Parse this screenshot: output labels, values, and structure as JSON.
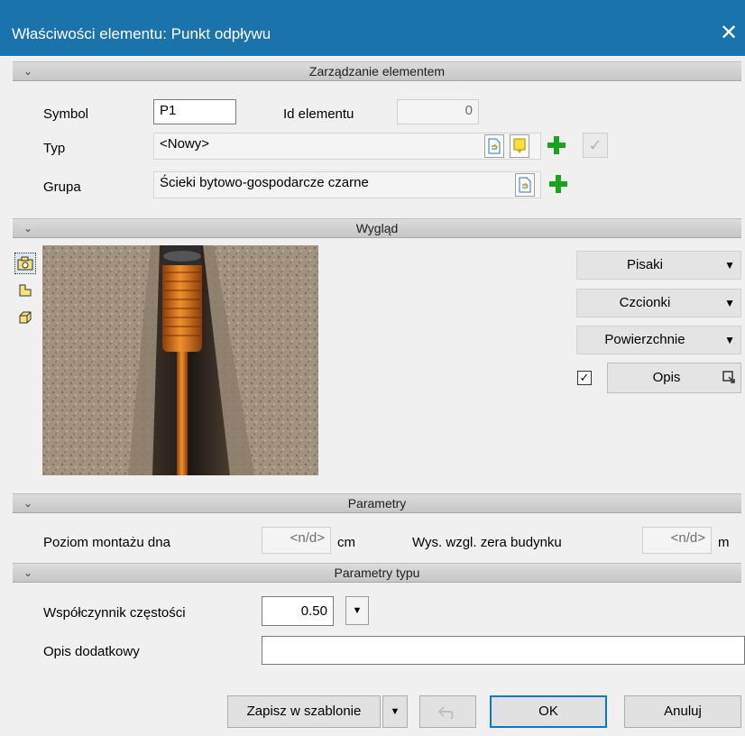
{
  "window": {
    "title": "Właściwości elementu: Punkt odpływu",
    "close_glyph": "✕"
  },
  "sections": {
    "management": "Zarządzanie elementem",
    "appearance": "Wygląd",
    "parameters": "Parametry",
    "type_parameters": "Parametry typu",
    "chevron_glyph": "⌄"
  },
  "management": {
    "symbol_label": "Symbol",
    "symbol_value": "P1",
    "id_label": "Id elementu",
    "id_value": "0",
    "type_label": "Typ",
    "type_value": "<Nowy>",
    "group_label": "Grupa",
    "group_value": "Ścieki bytowo-gospodarcze czarne",
    "apply_glyph": "✓"
  },
  "appearance": {
    "view_tabs": [
      "camera-icon",
      "plan-view-icon",
      "3d-box-icon"
    ],
    "pens_label": "Pisaki",
    "fonts_label": "Czcionki",
    "surfaces_label": "Powierzchnie",
    "dropdown_glyph": "▼",
    "description_checked": true,
    "description_check_glyph": "✓",
    "description_label": "Opis"
  },
  "parameters": {
    "mount_level_label": "Poziom montażu dna",
    "mount_level_value": "<n/d>",
    "mount_level_unit": "cm",
    "height_label": "Wys. wzgl. zera budynku",
    "height_value": "<n/d>",
    "height_unit": "m"
  },
  "type_parameters": {
    "frequency_label": "Współczynnik częstości",
    "frequency_value": "0.50",
    "extra_desc_label": "Opis dodatkowy",
    "extra_desc_value": ""
  },
  "footer": {
    "save_template_label": "Zapisz w szablonie",
    "ok_label": "OK",
    "cancel_label": "Anuluj"
  },
  "colors": {
    "titlebar": "#1a73aa",
    "plus_green": "#1aa21a",
    "ok_border": "#0078d7",
    "pipe_orange": "#d8701e"
  }
}
